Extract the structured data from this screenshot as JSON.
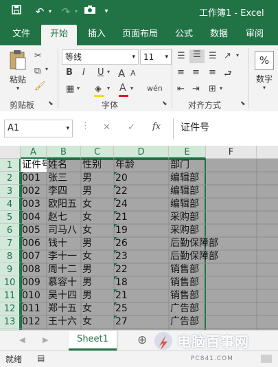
{
  "titlebar": {
    "save_icon": "save-icon",
    "undo_icon": "undo-icon",
    "redo_icon": "redo-icon",
    "camera_icon": "camera-icon",
    "customize_icon": "customize-quick-access-icon",
    "title": "工作簿1  -  Excel"
  },
  "tabs": [
    "文件",
    "开始",
    "插入",
    "页面布局",
    "公式",
    "数据",
    "审阅"
  ],
  "ribbon": {
    "paste_label": "粘贴",
    "clipboard_label": "剪贴板",
    "font_name": "等线",
    "font_size": "11",
    "bold": "B",
    "italic": "I",
    "underline": "U",
    "font_label": "字体",
    "alignment_label": "对齐方式",
    "number_symbol": "%",
    "number_label": "数字",
    "grow_font": "A",
    "shrink_font": "A",
    "font_color_glyph": "A",
    "phonetic_glyph": "wén"
  },
  "formula_bar": {
    "name_box": "A1",
    "cancel_glyph": "✕",
    "enter_glyph": "✓",
    "fx_glyph": "fx",
    "content": "证件号"
  },
  "columns": [
    "A",
    "B",
    "C",
    "D",
    "E",
    "F"
  ],
  "rows": [
    {
      "n": "1",
      "cells": [
        "证件号",
        "姓名",
        "性别",
        "年龄",
        "部门"
      ]
    },
    {
      "n": "2",
      "cells": [
        "001",
        "张三",
        "男",
        "20",
        "编辑部"
      ]
    },
    {
      "n": "3",
      "cells": [
        "002",
        "李四",
        "男",
        "22",
        "编辑部"
      ]
    },
    {
      "n": "4",
      "cells": [
        "003",
        "欧阳五",
        "女",
        "24",
        "编辑部"
      ]
    },
    {
      "n": "5",
      "cells": [
        "004",
        "赵七",
        "女",
        "21",
        "采购部"
      ]
    },
    {
      "n": "6",
      "cells": [
        "005",
        "司马八",
        "女",
        "19",
        "采购部"
      ]
    },
    {
      "n": "7",
      "cells": [
        "006",
        "钱十",
        "男",
        "26",
        "后勤保障部"
      ]
    },
    {
      "n": "8",
      "cells": [
        "007",
        "李十一",
        "女",
        "23",
        "后勤保障部"
      ]
    },
    {
      "n": "9",
      "cells": [
        "008",
        "周十二",
        "男",
        "22",
        "销售部"
      ]
    },
    {
      "n": "10",
      "cells": [
        "009",
        "慕容十",
        "男",
        "18",
        "销售部"
      ]
    },
    {
      "n": "11",
      "cells": [
        "010",
        "吴十四",
        "男",
        "21",
        "销售部"
      ]
    },
    {
      "n": "12",
      "cells": [
        "011",
        "郑十五",
        "女",
        "25",
        "广告部"
      ]
    },
    {
      "n": "13",
      "cells": [
        "012",
        "王十六",
        "女",
        "27",
        "广告部"
      ]
    }
  ],
  "sheet_tabs": {
    "active": "Sheet1",
    "add_glyph": "⊕"
  },
  "status": {
    "ready": "就绪"
  },
  "watermark": {
    "text": "电脑百事网",
    "sub": "PC841.COM"
  },
  "colors": {
    "excel_green": "#217346",
    "selection_gray": "#a6a6a6",
    "header_selected": "#d2e8d9"
  }
}
